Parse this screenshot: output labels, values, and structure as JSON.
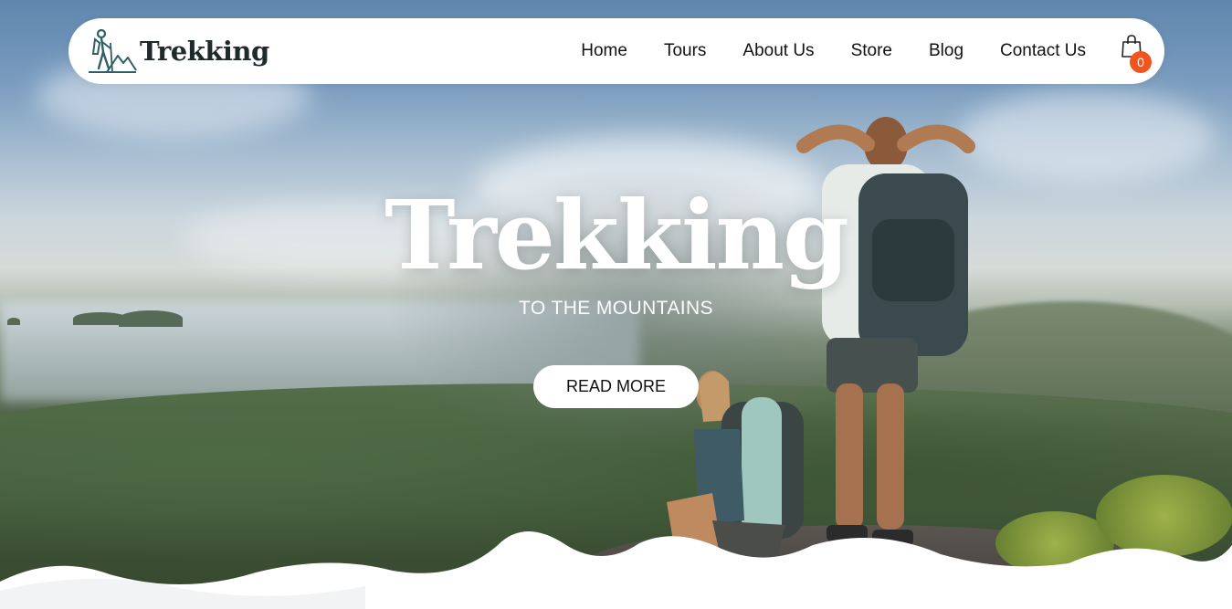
{
  "brand": {
    "name": "Trekking",
    "logo_icon": "hiker-mountain-icon"
  },
  "nav": {
    "items": [
      {
        "label": "Home"
      },
      {
        "label": "Tours"
      },
      {
        "label": "About Us"
      },
      {
        "label": "Store"
      },
      {
        "label": "Blog"
      },
      {
        "label": "Contact Us"
      }
    ],
    "cart": {
      "icon": "shopping-bag-icon",
      "count": "0"
    }
  },
  "hero": {
    "title": "Trekking",
    "subtitle": "TO THE MOUNTAINS",
    "cta_label": "READ MORE"
  },
  "colors": {
    "navbar_bg": "#ffffff",
    "text_dark": "#111111",
    "badge": "#f1551f",
    "brand_text": "#1e2a2c",
    "logo_teal": "#2f5f63"
  }
}
